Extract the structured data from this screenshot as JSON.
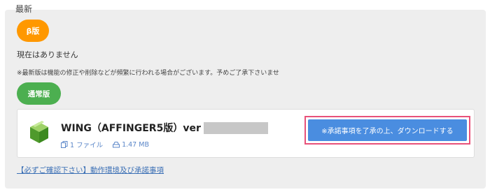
{
  "section": {
    "title": "最新"
  },
  "beta": {
    "badge_label": "β版",
    "empty_text": "現在はありません"
  },
  "notice": "※最新版は機能の修正や削除などが頻繁に行われる場合がございます。予めご了承下さいませ",
  "stable": {
    "badge_label": "通常版"
  },
  "product": {
    "title": "WING（AFFINGER5版）ver",
    "file_count": "1 ファイル",
    "file_size": "1.47 MB",
    "icon": "green-box-icon"
  },
  "download_button": "※承諾事項を了承の上、ダウンロードする",
  "footer_link": "【必ずご確認下さい】動作環境及び承諾事項",
  "colors": {
    "beta": "#ff9800",
    "stable": "#4caf50",
    "button": "#4a8de0",
    "highlight": "#e8517a",
    "link": "#3a6fb5"
  }
}
